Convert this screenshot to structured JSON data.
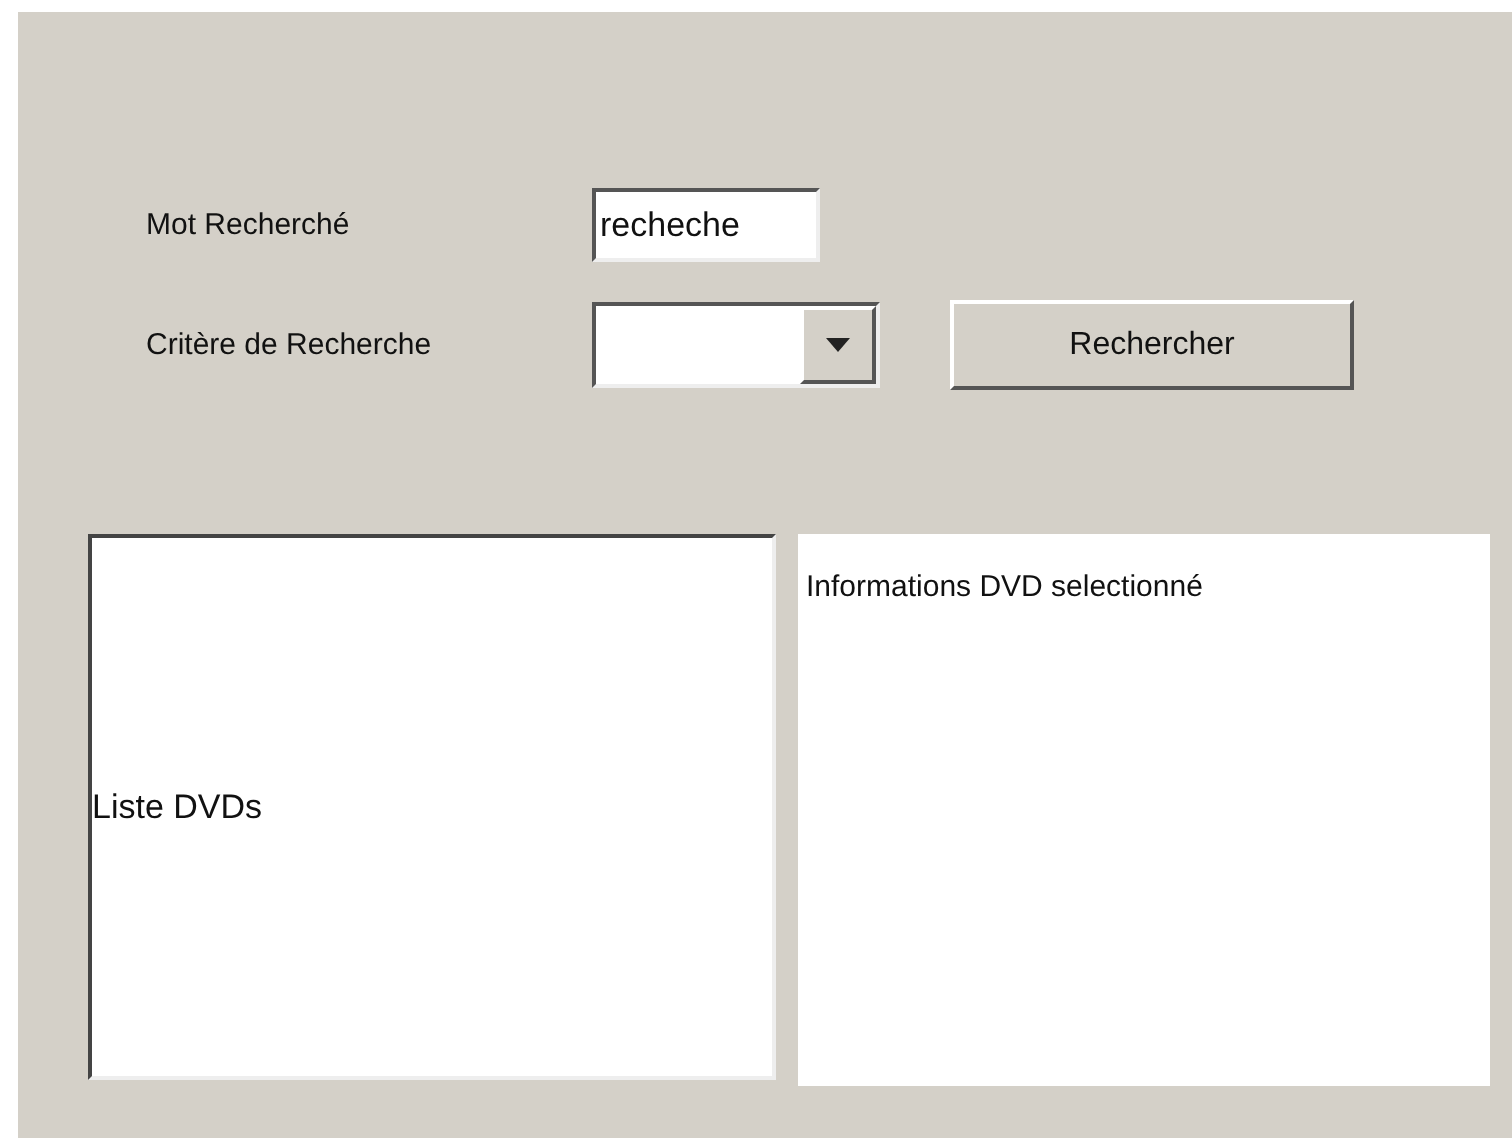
{
  "search_word": {
    "label": "Mot Recherché",
    "value": "recheche"
  },
  "criteria": {
    "label": "Critère de Recherche"
  },
  "search_button": {
    "label": "Rechercher"
  },
  "dvd_list": {
    "label": "Liste DVDs"
  },
  "details": {
    "label": "Informations DVD selectionné"
  }
}
